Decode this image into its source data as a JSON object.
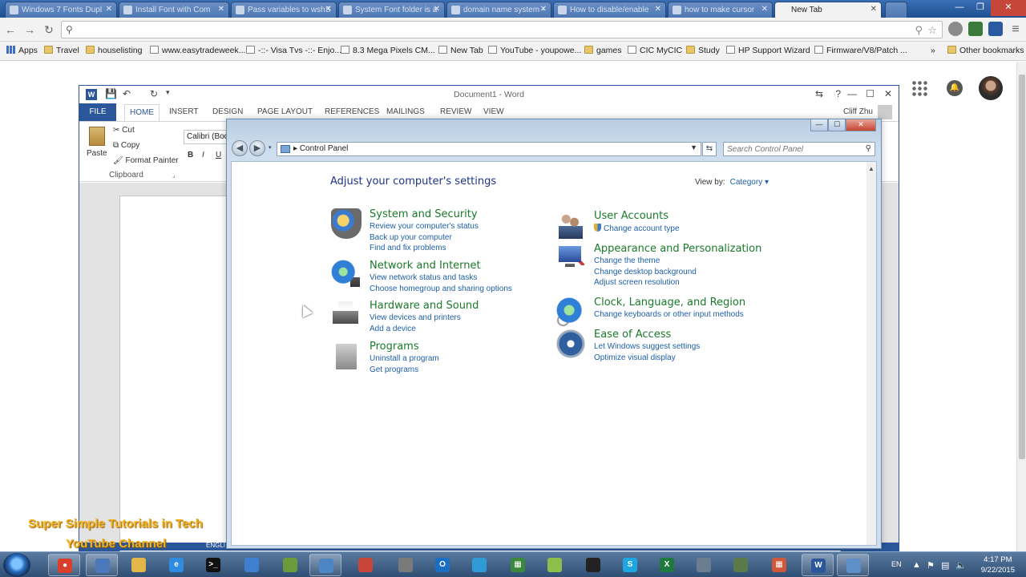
{
  "chrome": {
    "tabs": [
      {
        "label": "Windows 7 Fonts Dupl"
      },
      {
        "label": "Install Font with Com"
      },
      {
        "label": "Pass variables to wshS"
      },
      {
        "label": "System Font folder is a"
      },
      {
        "label": "domain name system -"
      },
      {
        "label": "How to disable/enable"
      },
      {
        "label": "how to make cursor"
      },
      {
        "label": "New Tab"
      }
    ],
    "omnibox": {
      "value": "",
      "placeholder": ""
    },
    "bookmarks": [
      {
        "label": "Apps"
      },
      {
        "label": "Travel"
      },
      {
        "label": "houselisting"
      },
      {
        "label": "www.easytradeweek..."
      },
      {
        "label": "-::- Visa Tvs -::- Enjo..."
      },
      {
        "label": "8.3 Mega Pixels CM..."
      },
      {
        "label": "New Tab"
      },
      {
        "label": "YouTube - youpowe..."
      },
      {
        "label": "games"
      },
      {
        "label": "CIC MyCIC"
      },
      {
        "label": "Study"
      },
      {
        "label": "HP Support Wizard"
      },
      {
        "label": "Firmware/V8/Patch ..."
      },
      {
        "label": "Other bookmarks"
      }
    ],
    "overflow": "»"
  },
  "word": {
    "logo": "W",
    "title": "Document1 - Word",
    "tabs": [
      "FILE",
      "HOME",
      "INSERT",
      "DESIGN",
      "PAGE LAYOUT",
      "REFERENCES",
      "MAILINGS",
      "REVIEW",
      "VIEW"
    ],
    "user": "Cliff Zhu",
    "clipboard": {
      "paste": "Paste",
      "cut": "Cut",
      "copy": "Copy",
      "format_painter": "Format Painter",
      "group": "Clipboard"
    },
    "font_name": "Calibri (Body",
    "format_buttons": [
      "B",
      "I",
      "U"
    ],
    "status_lang": "ENGLI"
  },
  "control_panel": {
    "breadcrumb": "Control Panel",
    "search_placeholder": "Search Control Panel",
    "heading": "Adjust your computer's settings",
    "view_by_label": "View by:",
    "view_by_value": "Category",
    "left": [
      {
        "title": "System and Security",
        "icon": "shield-icon",
        "links": [
          "Review your computer's status",
          "Back up your computer",
          "Find and fix problems"
        ]
      },
      {
        "title": "Network and Internet",
        "icon": "globe-network-icon",
        "links": [
          "View network status and tasks",
          "Choose homegroup and sharing options"
        ]
      },
      {
        "title": "Hardware and Sound",
        "icon": "printer-icon",
        "links": [
          "View devices and printers",
          "Add a device"
        ]
      },
      {
        "title": "Programs",
        "icon": "programs-icon",
        "links": [
          "Uninstall a program",
          "Get programs"
        ]
      }
    ],
    "right": [
      {
        "title": "User Accounts",
        "icon": "users-icon",
        "links": [
          "Change account type"
        ]
      },
      {
        "title": "Appearance and Personalization",
        "icon": "monitor-brush-icon",
        "links": [
          "Change the theme",
          "Change desktop background",
          "Adjust screen resolution"
        ]
      },
      {
        "title": "Clock, Language, and Region",
        "icon": "clock-globe-icon",
        "links": [
          "Change keyboards or other input methods"
        ]
      },
      {
        "title": "Ease of Access",
        "icon": "ease-access-icon",
        "links": [
          "Let Windows suggest settings",
          "Optimize visual display"
        ]
      }
    ]
  },
  "watermark": {
    "line1": "Super Simple Tutorials in Tech",
    "line2": "YouTube Channel"
  },
  "taskbar": {
    "lang": "EN",
    "time": "4:17 PM",
    "date": "9/22/2015",
    "items": [
      {
        "icon": "chrome-icon",
        "open": true,
        "color": "#d9402b"
      },
      {
        "icon": "computer-icon",
        "open": true,
        "color": "#4a78b8"
      },
      {
        "icon": "explorer-folder-icon",
        "open": false,
        "color": "#e3b64a"
      },
      {
        "icon": "ie-icon",
        "open": false,
        "color": "#2e8be0"
      },
      {
        "icon": "cmd-icon",
        "open": false,
        "color": "#111111"
      },
      {
        "icon": "globe-icon",
        "open": false,
        "color": "#3f7fd0"
      },
      {
        "icon": "tools-icon",
        "open": false,
        "color": "#6b9a3a"
      },
      {
        "icon": "network-icon",
        "open": true,
        "color": "#4d86c4"
      },
      {
        "icon": "search-tool-icon",
        "open": false,
        "color": "#c8453a"
      },
      {
        "icon": "triangle-icon",
        "open": false,
        "color": "#7a7a7a"
      },
      {
        "icon": "outlook-icon",
        "open": false,
        "color": "#1a6fc2"
      },
      {
        "icon": "connect-icon",
        "open": false,
        "color": "#2e9bd6"
      },
      {
        "icon": "sheet-icon",
        "open": false,
        "color": "#3b8a3b"
      },
      {
        "icon": "paint-icon",
        "open": false,
        "color": "#8bbf4a"
      },
      {
        "icon": "obs-icon",
        "open": false,
        "color": "#222222"
      },
      {
        "icon": "skype-icon",
        "open": false,
        "color": "#1ca7e0"
      },
      {
        "icon": "excel-icon",
        "open": false,
        "color": "#1f7a3e"
      },
      {
        "icon": "box-icon",
        "open": false,
        "color": "#6a7e90"
      },
      {
        "icon": "video-icon",
        "open": false,
        "color": "#5b7a4a"
      },
      {
        "icon": "apps-grid-icon",
        "open": false,
        "color": "#d0583a"
      },
      {
        "icon": "word-icon",
        "open": true,
        "color": "#2b579a"
      },
      {
        "icon": "control-panel-icon",
        "open": true,
        "color": "#5e8fc7"
      }
    ]
  }
}
